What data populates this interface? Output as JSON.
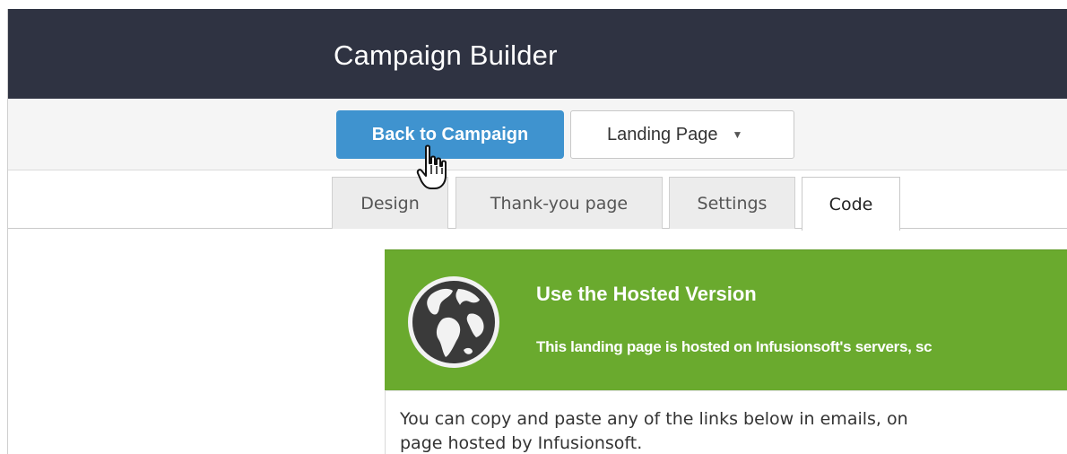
{
  "header": {
    "title": "Campaign Builder"
  },
  "toolbar": {
    "back_label": "Back to Campaign",
    "page_select": {
      "value": "Landing Page",
      "caret": "▼"
    }
  },
  "tabs": [
    {
      "label": "Design"
    },
    {
      "label": "Thank-you page"
    },
    {
      "label": "Settings"
    },
    {
      "label": "Code",
      "active": true
    }
  ],
  "hosted": {
    "title": "Use the Hosted Version",
    "subtitle": "This landing page is hosted on Infusionsoft's servers, sc",
    "icon": "globe-icon"
  },
  "body": {
    "line1": "You can copy and paste any of the links below in emails, on",
    "line2": "page hosted by Infusionsoft."
  },
  "colors": {
    "header_bg": "#2f3342",
    "primary_button": "#3f93cf",
    "hosted_banner": "#6aaa2e"
  }
}
